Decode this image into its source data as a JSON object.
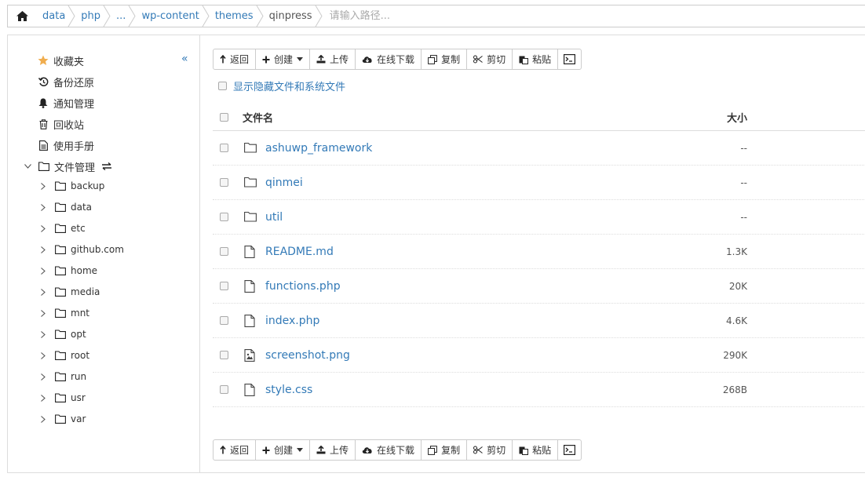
{
  "breadcrumb": {
    "items": [
      "data",
      "php",
      "...",
      "wp-content",
      "themes",
      "qinpress"
    ],
    "input_placeholder": "请输入路径..."
  },
  "sidebar": {
    "items": [
      {
        "label": "收藏夹",
        "icon": "star-icon"
      },
      {
        "label": "备份还原",
        "icon": "history-icon"
      },
      {
        "label": "通知管理",
        "icon": "bell-icon"
      },
      {
        "label": "回收站",
        "icon": "trash-icon"
      },
      {
        "label": "使用手册",
        "icon": "document-icon"
      },
      {
        "label": "文件管理",
        "icon": "folder-icon"
      }
    ],
    "collapse_label": "«",
    "tree": [
      "backup",
      "data",
      "etc",
      "github.com",
      "home",
      "media",
      "mnt",
      "opt",
      "root",
      "run",
      "usr",
      "var"
    ]
  },
  "toolbar": {
    "back": "返回",
    "create": "创建",
    "upload": "上传",
    "download": "在线下载",
    "copy": "复制",
    "cut": "剪切",
    "paste": "粘贴"
  },
  "show_hidden_label": "显示隐藏文件和系统文件",
  "table": {
    "col_name": "文件名",
    "col_size": "大小",
    "rows": [
      {
        "name": "ashuwp_framework",
        "size": "--",
        "type": "folder"
      },
      {
        "name": "qinmei",
        "size": "--",
        "type": "folder"
      },
      {
        "name": "util",
        "size": "--",
        "type": "folder"
      },
      {
        "name": "README.md",
        "size": "1.3K",
        "type": "file"
      },
      {
        "name": "functions.php",
        "size": "20K",
        "type": "file"
      },
      {
        "name": "index.php",
        "size": "4.6K",
        "type": "file"
      },
      {
        "name": "screenshot.png",
        "size": "290K",
        "type": "image"
      },
      {
        "name": "style.css",
        "size": "268B",
        "type": "file"
      }
    ]
  },
  "colors": {
    "link": "#337ab7",
    "star": "#f0ad4e",
    "border": "#cccccc"
  }
}
